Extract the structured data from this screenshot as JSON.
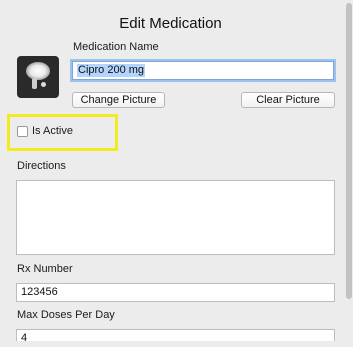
{
  "dialog": {
    "title": "Edit Medication"
  },
  "medication": {
    "thumbnail_icon": "pill-bottle-photo-icon",
    "name_label": "Medication Name",
    "name_value": "Cipro 200 mg",
    "change_picture_label": "Change Picture",
    "clear_picture_label": "Clear Picture"
  },
  "active": {
    "label": "Is Active",
    "checked": false,
    "highlight_color": "#f1ec1f"
  },
  "directions": {
    "label": "Directions",
    "value": ""
  },
  "rx": {
    "label": "Rx Number",
    "value": "123456"
  },
  "max_doses": {
    "label": "Max Doses Per Day",
    "value": "4"
  },
  "colors": {
    "focus_ring": "#9cc2ee",
    "selection": "#b3d4fc"
  }
}
